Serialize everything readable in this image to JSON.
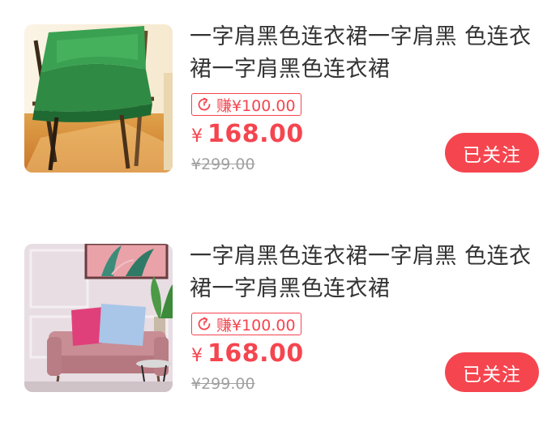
{
  "colors": {
    "accent": "#f5454f",
    "text": "#333333",
    "muted": "#a0a0a0"
  },
  "products": [
    {
      "title": "一字肩黑色连衣裙一字肩黑 色连衣裙一字肩黑色连衣裙",
      "earn_label": "赚¥100.00",
      "earn_icon": "refresh-icon",
      "currency": "¥",
      "price": "168.00",
      "original_price": "¥299.00",
      "follow_label": "已关注",
      "image": "green-chair-photo"
    },
    {
      "title": "一字肩黑色连衣裙一字肩黑 色连衣裙一字肩黑色连衣裙",
      "earn_label": "赚¥100.00",
      "earn_icon": "refresh-icon",
      "currency": "¥",
      "price": "168.00",
      "original_price": "¥299.00",
      "follow_label": "已关注",
      "image": "pink-sofa-photo"
    }
  ]
}
